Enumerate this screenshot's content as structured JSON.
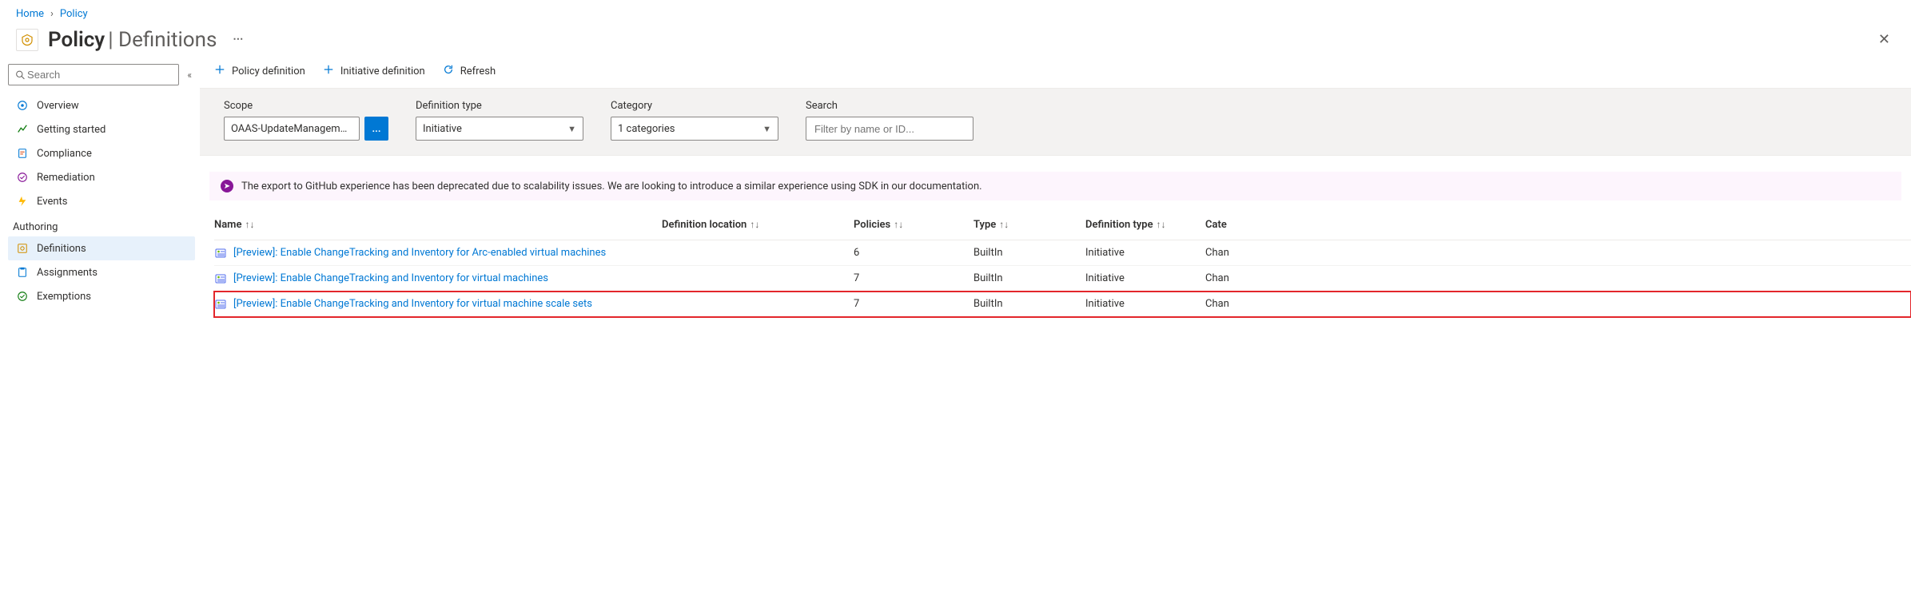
{
  "breadcrumb": {
    "home": "Home",
    "policy": "Policy"
  },
  "header": {
    "title_strong": "Policy",
    "title_light": "Definitions"
  },
  "sidebar": {
    "search_placeholder": "Search",
    "items": [
      {
        "label": "Overview"
      },
      {
        "label": "Getting started"
      },
      {
        "label": "Compliance"
      },
      {
        "label": "Remediation"
      },
      {
        "label": "Events"
      }
    ],
    "authoring_label": "Authoring",
    "authoring_items": [
      {
        "label": "Definitions"
      },
      {
        "label": "Assignments"
      },
      {
        "label": "Exemptions"
      }
    ]
  },
  "commands": {
    "policy_def": "Policy definition",
    "initiative_def": "Initiative definition",
    "refresh": "Refresh"
  },
  "filters": {
    "scope_label": "Scope",
    "scope_value": "OAAS-UpdateManagem…",
    "deftype_label": "Definition type",
    "deftype_value": "Initiative",
    "category_label": "Category",
    "category_value": "1 categories",
    "search_label": "Search",
    "search_placeholder": "Filter by name or ID..."
  },
  "notice": "The export to GitHub experience has been deprecated due to scalability issues. We are looking to introduce a similar experience using SDK in our documentation.",
  "grid": {
    "headers": {
      "name": "Name",
      "location": "Definition location",
      "policies": "Policies",
      "type": "Type",
      "deftype": "Definition type",
      "category": "Cate"
    },
    "rows": [
      {
        "name": "[Preview]: Enable ChangeTracking and Inventory for Arc-enabled virtual machines",
        "location": "",
        "policies": "6",
        "type": "BuiltIn",
        "deftype": "Initiative",
        "category": "Chan",
        "highlight": false
      },
      {
        "name": "[Preview]: Enable ChangeTracking and Inventory for virtual machines",
        "location": "",
        "policies": "7",
        "type": "BuiltIn",
        "deftype": "Initiative",
        "category": "Chan",
        "highlight": false
      },
      {
        "name": "[Preview]: Enable ChangeTracking and Inventory for virtual machine scale sets",
        "location": "",
        "policies": "7",
        "type": "BuiltIn",
        "deftype": "Initiative",
        "category": "Chan",
        "highlight": true
      }
    ]
  }
}
